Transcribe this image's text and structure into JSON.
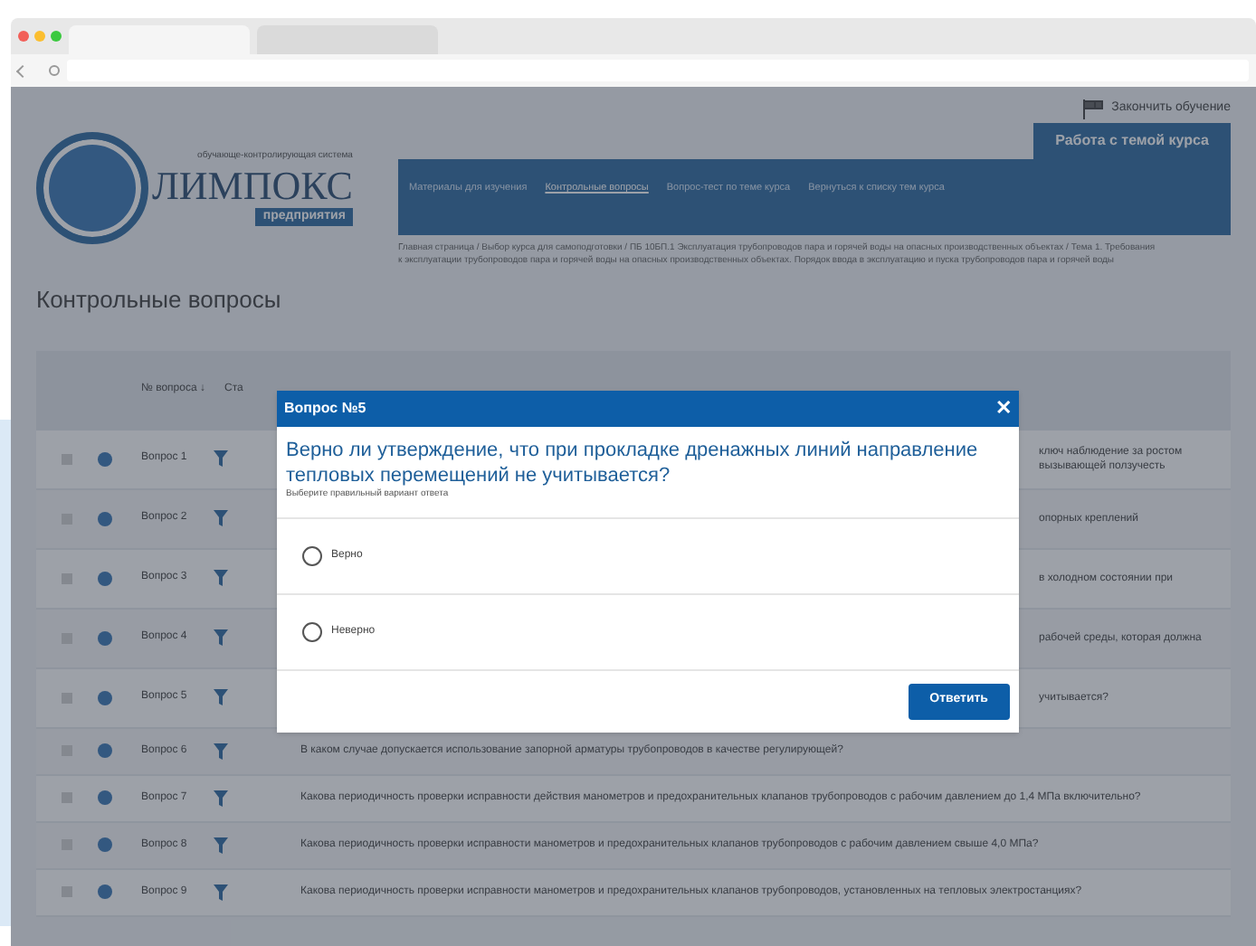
{
  "browser": {
    "tabs": [
      {
        "selected": true
      },
      {
        "selected": false
      }
    ]
  },
  "header": {
    "finish_link": "Закончить обучение",
    "logo": {
      "tagline": "обучающе-контролирующая система",
      "name": "ЛИМПОКС",
      "badge": "предприятия"
    },
    "section_tab": "Работа с темой курса",
    "nav": [
      {
        "label": "Материалы для изучения",
        "selected": false
      },
      {
        "label": "Контрольные вопросы",
        "selected": true
      },
      {
        "label": "Вопрос-тест по теме курса",
        "selected": false
      },
      {
        "label": "Вернуться к списку тем курса",
        "selected": false
      }
    ],
    "breadcrumb": "Главная страница / Выбор курса для самоподготовки / ПБ 10БП.1 Эксплуатация трубопроводов пара и горячей воды на опасных производственных объектах / Тема 1. Требования к эксплуатации трубопроводов пара и горячей воды на опасных производственных объектах. Порядок ввода в эксплуатацию и пуска трубопроводов пара и горячей воды"
  },
  "page_title": "Контрольные вопросы",
  "table": {
    "columns": [
      "№ вопроса ↓",
      "Ста"
    ],
    "rows": [
      {
        "number": "Вопрос 1",
        "checked": false,
        "kind": "covered",
        "question": "ключ наблюдение за ростом вызывающей ползучесть"
      },
      {
        "number": "Вопрос 2",
        "checked": false,
        "kind": "covered",
        "question": "опорных креплений"
      },
      {
        "number": "Вопрос 3",
        "checked": false,
        "kind": "covered",
        "question": "в холодном состоянии при"
      },
      {
        "number": "Вопрос 4",
        "checked": false,
        "kind": "covered",
        "question": "рабочей среды, которая должна"
      },
      {
        "number": "Вопрос 5",
        "checked": false,
        "kind": "covered",
        "question": "учитывается?"
      },
      {
        "number": "Вопрос 6",
        "checked": false,
        "kind": "full",
        "question": "В каком случае допускается использование запорной арматуры трубопроводов в качестве регулирующей?"
      },
      {
        "number": "Вопрос 7",
        "checked": false,
        "kind": "full",
        "question": "Какова периодичность проверки исправности действия манометров и предохранительных клапанов трубопроводов с рабочим давлением до 1,4 МПа включительно?"
      },
      {
        "number": "Вопрос 8",
        "checked": false,
        "kind": "full",
        "question": "Какова периодичность проверки исправности манометров и предохранительных клапанов трубопроводов с рабочим давлением свыше 4,0 МПа?"
      },
      {
        "number": "Вопрос 9",
        "checked": false,
        "kind": "full",
        "question": "Какова периодичность проверки исправности манометров и предохранительных клапанов трубопроводов, установленных на тепловых электростанциях?"
      }
    ]
  },
  "dialog": {
    "title": "Вопрос №5",
    "close": "✕",
    "question": "Верно ли утверждение, что при прокладке дренажных линий направление тепловых перемещений не учитывается?",
    "hint": "Выберите правильный вариант ответа",
    "options": [
      {
        "label": "Верно",
        "selected": false
      },
      {
        "label": "Неверно",
        "selected": false
      }
    ],
    "submit": "Ответить"
  }
}
